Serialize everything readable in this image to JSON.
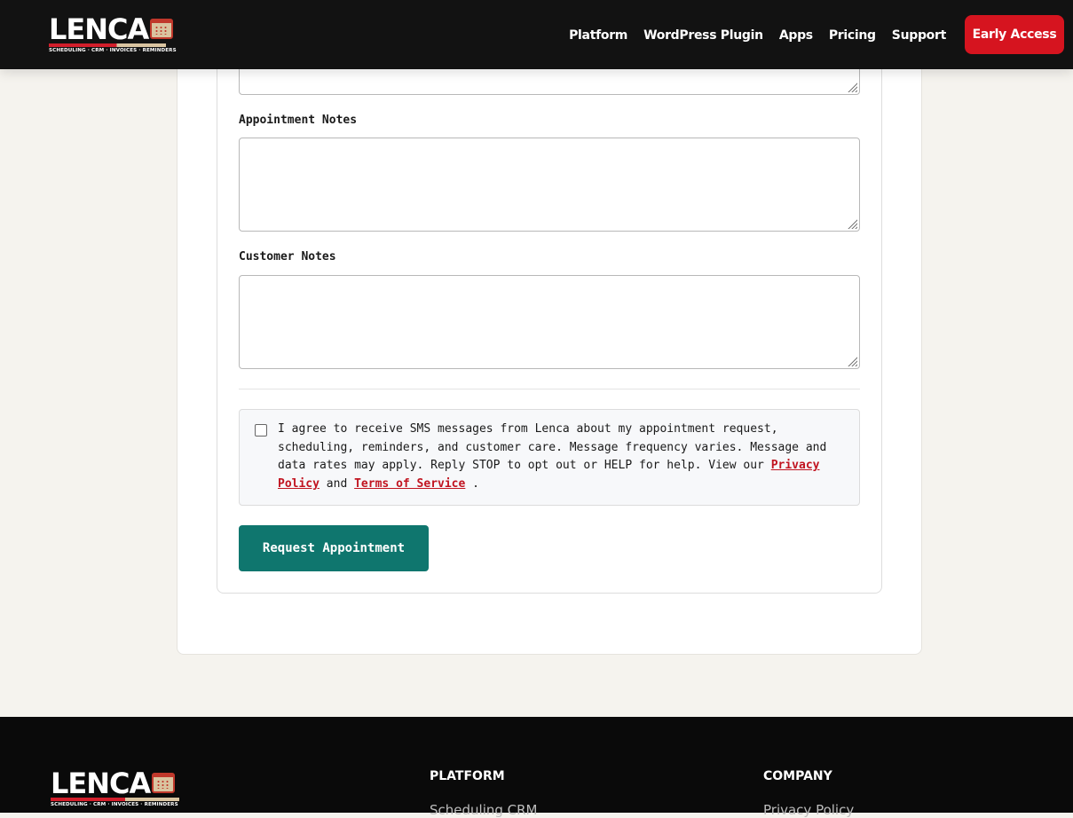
{
  "brand": {
    "name": "LENCA",
    "tagline": "SCHEDULING · CRM · INVOICES · REMINDERS"
  },
  "nav": {
    "items": [
      "Platform",
      "WordPress Plugin",
      "Apps",
      "Pricing",
      "Support"
    ],
    "cta": "Early Access"
  },
  "form": {
    "appointment_notes_label": "Appointment Notes",
    "customer_notes_label": "Customer Notes",
    "consent": {
      "text_before": "I agree to receive SMS messages from Lenca about my appointment request, scheduling, reminders, and customer care. Message frequency varies. Message and data rates may apply. Reply STOP to opt out or HELP for help. View our ",
      "privacy_link": "Privacy Policy",
      "and": " and ",
      "terms_link": "Terms of Service",
      "period": " ."
    },
    "submit_label": "Request Appointment"
  },
  "footer": {
    "platform_heading": "PLATFORM",
    "platform_first_link": "Scheduling CRM",
    "company_heading": "COMPANY",
    "company_first_link": "Privacy Policy"
  },
  "colors": {
    "header_bg": "#121212",
    "cta_red": "#d6141f",
    "submit_teal": "#0f766e",
    "link_red": "#c11420",
    "page_bg": "#f5f3ee"
  }
}
